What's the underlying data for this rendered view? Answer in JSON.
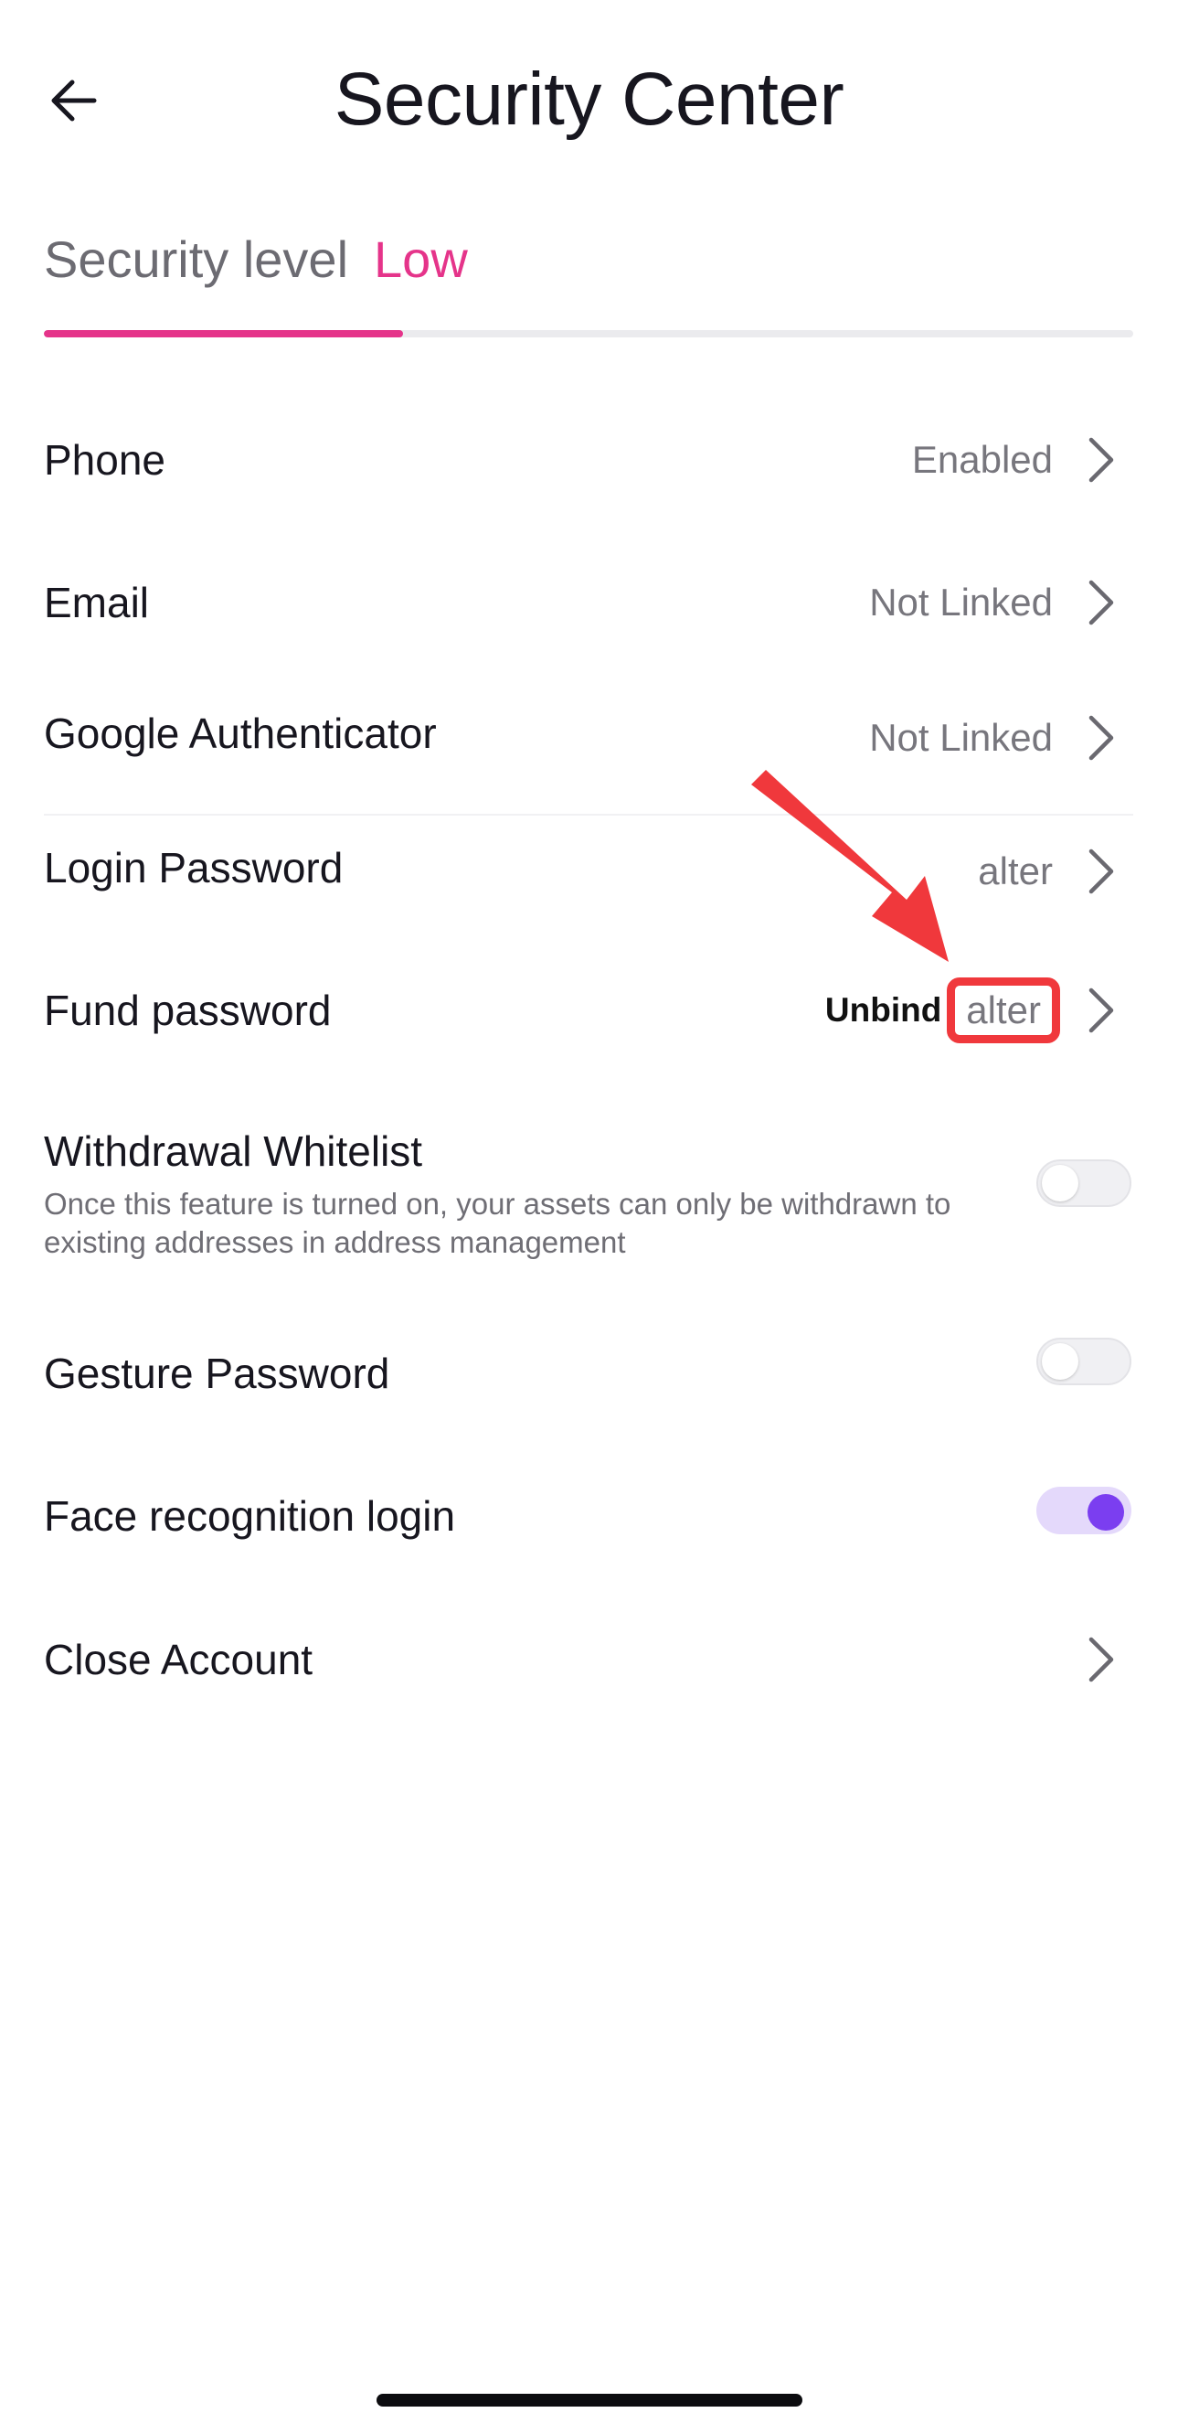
{
  "header": {
    "title": "Security Center",
    "back_icon": "arrow-left-icon"
  },
  "security_level": {
    "label": "Security level",
    "value": "Low",
    "progress": 0.33,
    "accent_color": "#e5348a"
  },
  "items": [
    {
      "id": "phone",
      "label": "Phone",
      "value": "Enabled"
    },
    {
      "id": "email",
      "label": "Email",
      "value": "Not Linked"
    },
    {
      "id": "google",
      "label": "Google Authenticator",
      "value": "Not Linked"
    },
    {
      "id": "login",
      "label": "Login Password",
      "value": "alter"
    },
    {
      "id": "fund",
      "label": "Fund password",
      "secondary": "Unbind",
      "value": "alter"
    },
    {
      "id": "close",
      "label": "Close Account"
    }
  ],
  "whitelist": {
    "title": "Withdrawal Whitelist",
    "description": "Once this feature is turned on, your assets can only be withdrawn to existing addresses in address management",
    "enabled": false
  },
  "gesture": {
    "label": "Gesture Password",
    "enabled": false
  },
  "face": {
    "label": "Face recognition login",
    "enabled": true,
    "accent_color": "#7b3ef0"
  },
  "annotation": {
    "highlight_color": "#f0383c",
    "icon": "red-arrow-icon"
  }
}
